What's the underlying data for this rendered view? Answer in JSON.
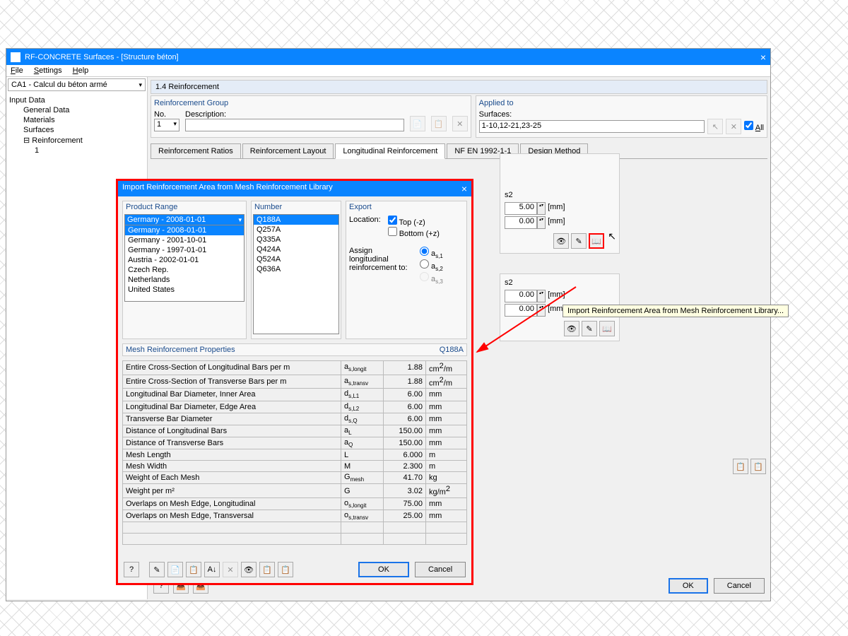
{
  "main_window": {
    "title": "RF-CONCRETE Surfaces - [Structure béton]",
    "menus": {
      "file": "File",
      "settings": "Settings",
      "help": "Help"
    },
    "calc_dropdown": "CA1 - Calcul du béton armé",
    "tree": {
      "root": "Input Data",
      "items": [
        "General Data",
        "Materials",
        "Surfaces",
        "Reinforcement"
      ],
      "sub": "1"
    },
    "section": "1.4 Reinforcement",
    "reinforcement_group": {
      "title": "Reinforcement Group",
      "no_label": "No.",
      "no_value": "1",
      "desc_label": "Description:"
    },
    "applied_to": {
      "title": "Applied to",
      "surf_label": "Surfaces:",
      "surf_value": "1-10,12-21,23-25",
      "all": "All"
    },
    "tabs": [
      "Reinforcement Ratios",
      "Reinforcement Layout",
      "Longitudinal Reinforcement",
      "NF EN 1992-1-1",
      "Design Method"
    ],
    "spin_s2": "s2",
    "spin_val1": "5.00",
    "spin_val2": "0.00",
    "unit_mm": "[mm]",
    "spin_val3": "0.00",
    "spin_val4": "0.00",
    "tooltip": "Import Reinforcement Area from Mesh Reinforcement Library...",
    "ok": "OK",
    "cancel": "Cancel"
  },
  "dialog": {
    "title": "Import Reinforcement Area from Mesh Reinforcement Library",
    "product_range": {
      "title": "Product Range",
      "selected": "Germany - 2008-01-01",
      "options": [
        "Germany - 2008-01-01",
        "Germany - 2001-10-01",
        "Germany - 1997-01-01",
        "Austria - 2002-01-01",
        "Czech Rep.",
        "Netherlands",
        "United States"
      ]
    },
    "number": {
      "title": "Number",
      "items": [
        "Q188A",
        "Q257A",
        "Q335A",
        "Q424A",
        "Q524A",
        "Q636A"
      ]
    },
    "export": {
      "title": "Export",
      "location": "Location:",
      "top": "Top (-z)",
      "bottom": "Bottom (+z)",
      "assign": "Assign longitudinal reinforcement to:",
      "a1": "as,1",
      "a2": "as,2",
      "a3": "as,3"
    },
    "props_title": "Mesh Reinforcement Properties",
    "props_id": "Q188A",
    "props": [
      {
        "n": "Entire Cross-Section of Longitudinal Bars per m",
        "s": "a s,longit",
        "v": "1.88",
        "u": "cm²/m"
      },
      {
        "n": "Entire Cross-Section of Transverse Bars per m",
        "s": "a s,transv",
        "v": "1.88",
        "u": "cm²/m"
      },
      {
        "n": "Longitudinal Bar Diameter, Inner Area",
        "s": "d s,L1",
        "v": "6.00",
        "u": "mm"
      },
      {
        "n": "Longitudinal Bar Diameter, Edge Area",
        "s": "d s,L2",
        "v": "6.00",
        "u": "mm"
      },
      {
        "n": "Transverse Bar Diameter",
        "s": "d s,Q",
        "v": "6.00",
        "u": "mm"
      },
      {
        "n": "Distance of Longitudinal Bars",
        "s": "a L",
        "v": "150.00",
        "u": "mm"
      },
      {
        "n": "Distance of Transverse Bars",
        "s": "a Q",
        "v": "150.00",
        "u": "mm"
      },
      {
        "n": "Mesh Length",
        "s": "L",
        "v": "6.000",
        "u": "m"
      },
      {
        "n": "Mesh Width",
        "s": "M",
        "v": "2.300",
        "u": "m"
      },
      {
        "n": "Weight of Each Mesh",
        "s": "G mesh",
        "v": "41.70",
        "u": "kg"
      },
      {
        "n": "Weight per m²",
        "s": "G",
        "v": "3.02",
        "u": "kg/m²"
      },
      {
        "n": "Overlaps on Mesh Edge, Longitudinal",
        "s": "o s,longit",
        "v": "75.00",
        "u": "mm"
      },
      {
        "n": "Overlaps on Mesh Edge, Transversal",
        "s": "o s,transv",
        "v": "25.00",
        "u": "mm"
      }
    ],
    "ok": "OK",
    "cancel": "Cancel"
  }
}
